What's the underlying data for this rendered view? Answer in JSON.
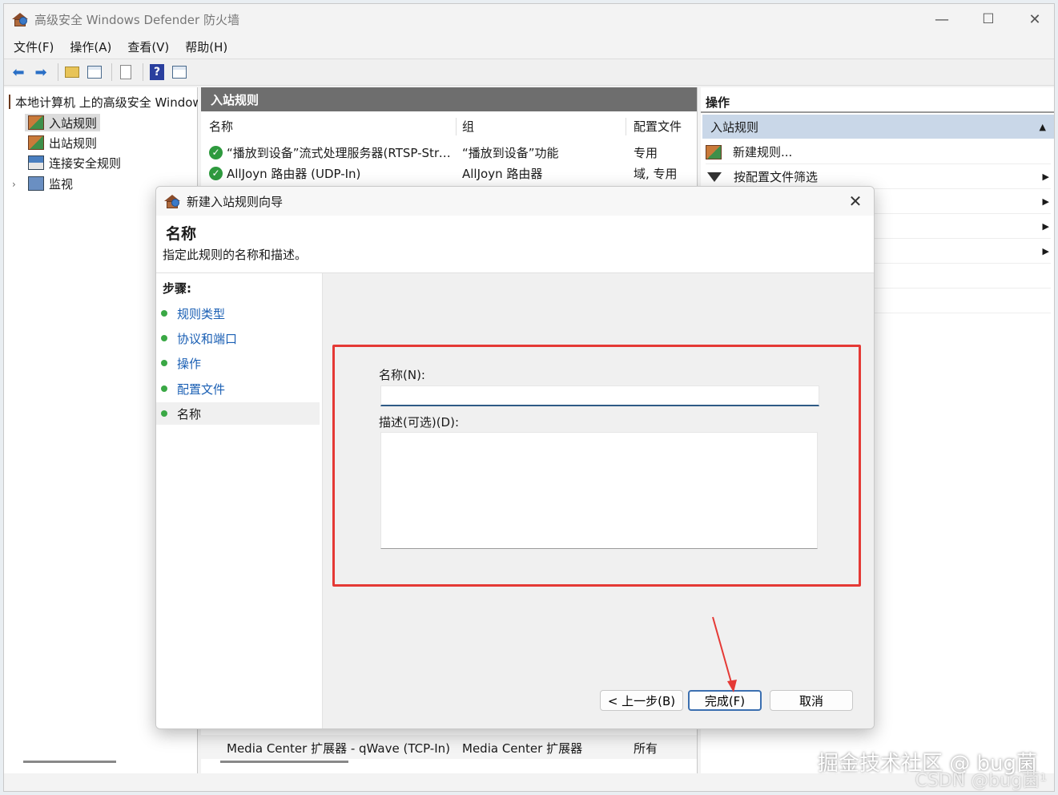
{
  "window": {
    "title": "高级安全 Windows Defender 防火墙",
    "minimize": "—",
    "maximize": "☐",
    "close": "✕"
  },
  "menu": [
    "文件(F)",
    "操作(A)",
    "查看(V)",
    "帮助(H)"
  ],
  "tree": {
    "root": "本地计算机 上的高级安全 Windows Defender 防火墙",
    "items": [
      "入站规则",
      "出站规则",
      "连接安全规则",
      "监视"
    ]
  },
  "center": {
    "header": "入站规则",
    "columns": [
      "名称",
      "组",
      "配置文件"
    ],
    "rows": [
      {
        "name": "“播放到设备”流式处理服务器(RTSP-Streaming-In)",
        "group": "“播放到设备”功能",
        "profile": "专用"
      },
      {
        "name": "AllJoyn 路由器 (UDP-In)",
        "group": "AllJoyn 路由器",
        "profile": "域, 专用"
      }
    ],
    "bottom_row": {
      "name": "Media Center 扩展器 - qWave (TCP-In)",
      "group": "Media Center 扩展器",
      "profile": "所有"
    }
  },
  "actions": {
    "title": "操作",
    "section": "入站规则",
    "items": [
      "新建规则...",
      "按配置文件筛选"
    ]
  },
  "dialog": {
    "title": "新建入站规则向导",
    "close": "✕",
    "heading": "名称",
    "subheading": "指定此规则的名称和描述。",
    "steps_title": "步骤:",
    "steps": [
      "规则类型",
      "协议和端口",
      "操作",
      "配置文件",
      "名称"
    ],
    "name_label": "名称(N):",
    "name_value": "",
    "desc_label": "描述(可选)(D):",
    "desc_value": "",
    "buttons": {
      "back": "< 上一步(B)",
      "finish": "完成(F)",
      "cancel": "取消"
    }
  },
  "watermark": {
    "line1": "掘金技术社区 @ bug菌",
    "line2": "CSDN @bug菌¹"
  },
  "colors": {
    "highlight_box": "#e53935",
    "arrow": "#e53935",
    "check": "#2e9a3e",
    "link": "#1a5fb4"
  }
}
